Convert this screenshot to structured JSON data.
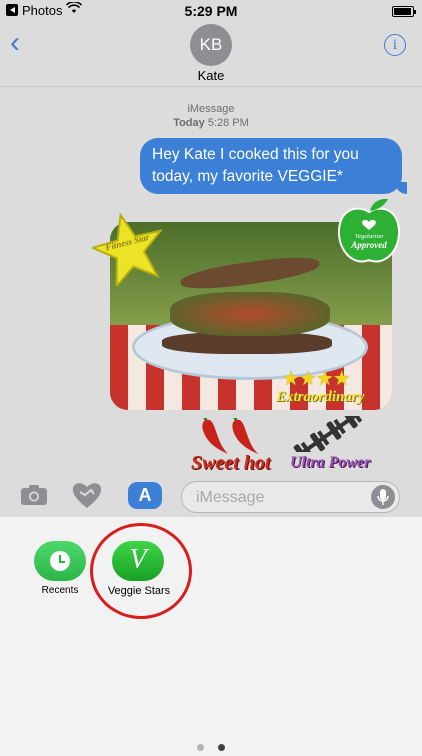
{
  "status_bar": {
    "app": "Photos",
    "time": "5:29 PM"
  },
  "header": {
    "back_icon": "chevron-left-icon",
    "avatar_initials": "KB",
    "contact_name": "Kate",
    "info_icon": "info-icon"
  },
  "conversation": {
    "service": "iMessage",
    "day": "Today",
    "time": "5:28 PM",
    "message": "Hey Kate I cooked this for you today, my favorite VEGGIE*"
  },
  "stickers": {
    "fitness_star": "Fitness Star",
    "apple_line1": "Vegetarian",
    "apple_line2": "Approved",
    "extraordinary": "Extraordinary",
    "sweet_hot": "Sweet hot",
    "ultra_power": "Ultra Power"
  },
  "input_bar": {
    "placeholder": "iMessage",
    "camera_icon": "camera-icon",
    "digital_touch_icon": "heart-icon",
    "app_store_icon": "app-store-icon",
    "mic_icon": "microphone-icon"
  },
  "app_drawer": {
    "apps": [
      {
        "label": "Recents",
        "icon": "clock-icon"
      },
      {
        "label": "Veggie Stars",
        "icon": "veggie-stars-v-icon",
        "glyph": "V"
      }
    ],
    "highlight_color": "#d81d1d",
    "page_indicator": {
      "pages": 2,
      "current": 2
    }
  },
  "colors": {
    "imessage_blue": "#3b7fd6",
    "app_green": "#2bb64a"
  }
}
